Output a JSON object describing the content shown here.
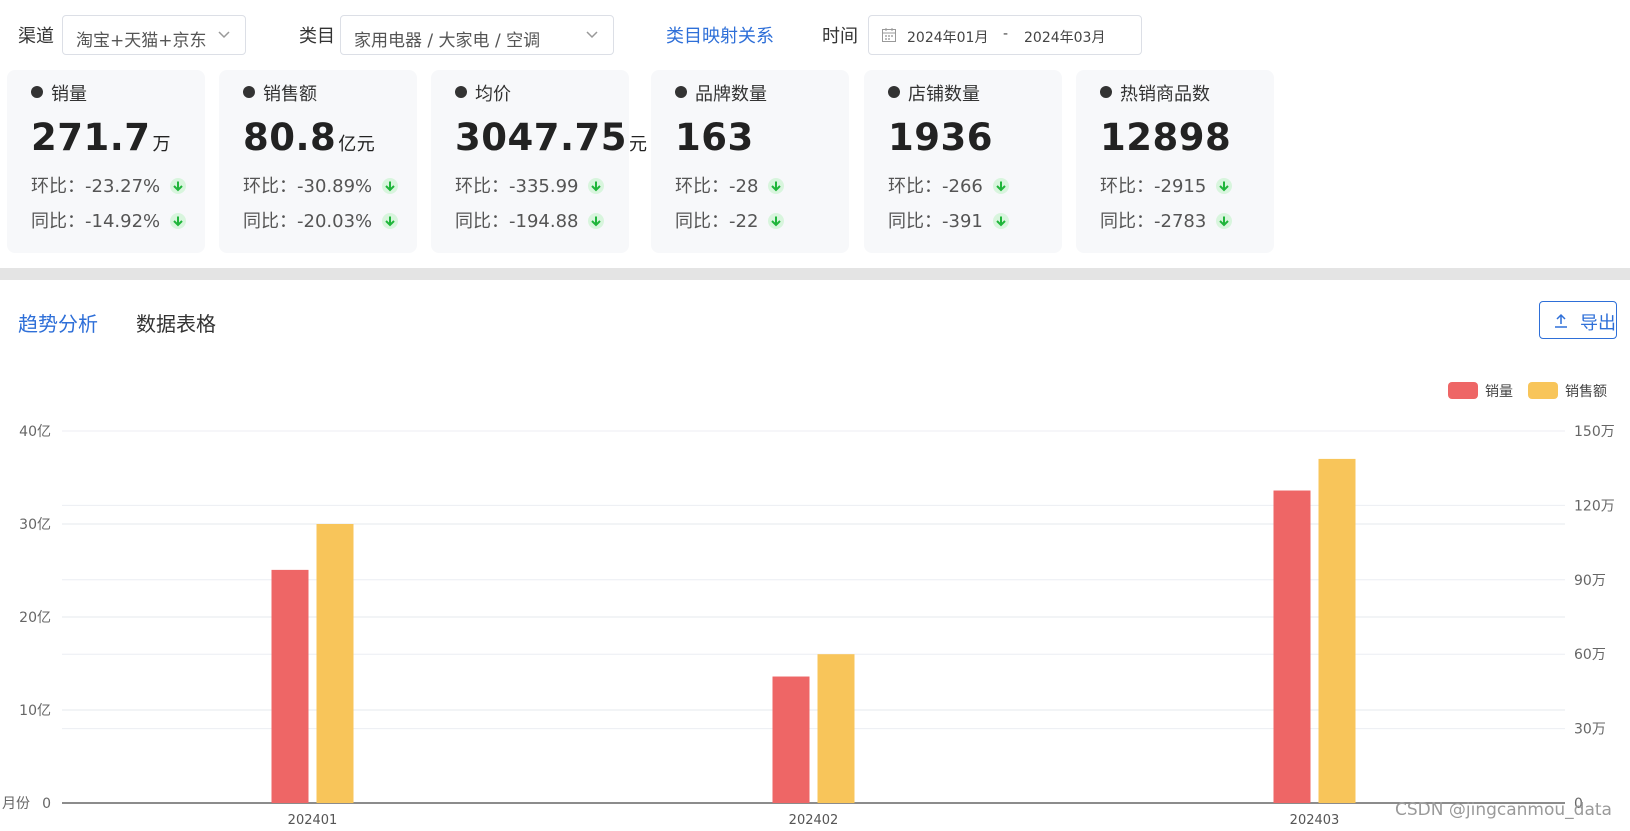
{
  "filters": {
    "channel_label": "渠道",
    "channel_value": "淘宝+天猫+京东",
    "category_label": "类目",
    "category_value": "家用电器 / 大家电 / 空调",
    "category_mapping_link": "类目映射关系",
    "time_label": "时间",
    "date_start": "2024年01月",
    "date_sep": "-",
    "date_end": "2024年03月"
  },
  "metrics": [
    {
      "title": "销量",
      "value": "271.7",
      "unit": "万",
      "mom": "环比：-23.27%",
      "yoy": "同比：-14.92%"
    },
    {
      "title": "销售额",
      "value": "80.8",
      "unit": "亿元",
      "mom": "环比：-30.89%",
      "yoy": "同比：-20.03%"
    },
    {
      "title": "均价",
      "value": "3047.75",
      "unit": "元",
      "mom": "环比：-335.99",
      "yoy": "同比：-194.88"
    },
    {
      "title": "品牌数量",
      "value": "163",
      "unit": "",
      "mom": "环比：-28",
      "yoy": "同比：-22"
    },
    {
      "title": "店铺数量",
      "value": "1936",
      "unit": "",
      "mom": "环比：-266",
      "yoy": "同比：-391"
    },
    {
      "title": "热销商品数",
      "value": "12898",
      "unit": "",
      "mom": "环比：-2915",
      "yoy": "同比：-2783"
    }
  ],
  "tabs": {
    "trend": "趋势分析",
    "table": "数据表格"
  },
  "export_label": "导出",
  "watermark": "CSDN @jingcanmou_data",
  "colors": {
    "accent": "#2e6fd8",
    "series_sales_volume": "#ee6666",
    "series_sales_amount": "#f8c55a",
    "down_arrow": "#1fb53a"
  },
  "chart_data": {
    "type": "bar",
    "categories": [
      "202401",
      "202402",
      "202403"
    ],
    "series": [
      {
        "name": "销量",
        "axis": "right",
        "values": [
          94,
          51,
          126
        ]
      },
      {
        "name": "销售额",
        "axis": "left",
        "values": [
          30,
          16,
          37
        ]
      }
    ],
    "yleft_ticks": [
      "0",
      "10亿",
      "20亿",
      "30亿",
      "40亿"
    ],
    "yleft_label": "月份",
    "yleft_range": [
      0,
      40
    ],
    "yright_ticks": [
      "0",
      "30万",
      "60万",
      "90万",
      "120万",
      "150万"
    ],
    "yright_range": [
      0,
      150
    ],
    "legend_position": "top-right",
    "grid": true
  }
}
